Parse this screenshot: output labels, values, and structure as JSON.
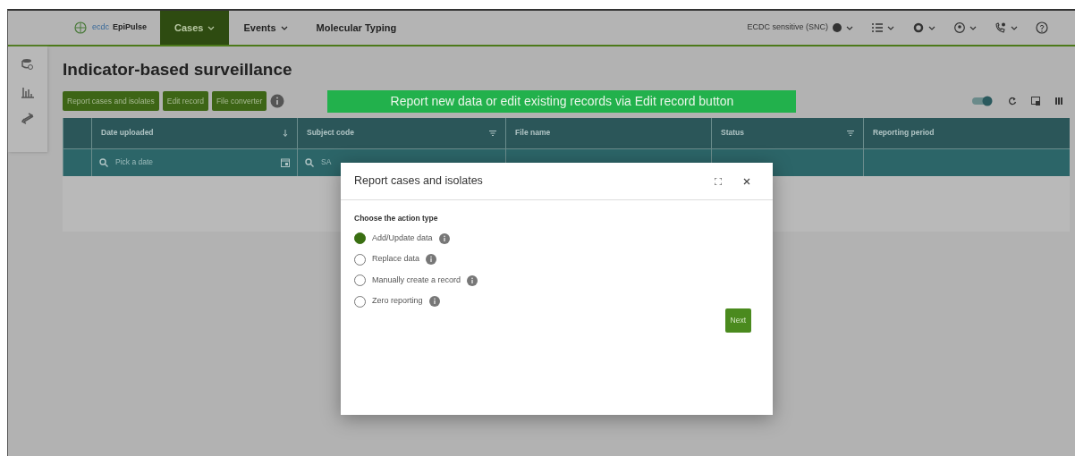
{
  "navbar": {
    "brand": "EpiPulse",
    "logo_text": "ecdc",
    "menus": [
      {
        "label": "Cases",
        "selected": true,
        "dropdown": true
      },
      {
        "label": "Events",
        "selected": false,
        "dropdown": true
      },
      {
        "label": "Molecular Typing",
        "selected": false,
        "dropdown": false
      }
    ],
    "sensitivity": "ECDC sensitive (SNC)"
  },
  "page": {
    "title": "Indicator-based surveillance",
    "actions": [
      "Report cases and isolates",
      "Edit record",
      "File converter"
    ],
    "banner": "Report new data or edit existing records via Edit record button",
    "toggle": {
      "on": true
    }
  },
  "table": {
    "columns": [
      {
        "label": "Date uploaded",
        "kind": "sort"
      },
      {
        "label": "Subject code",
        "kind": "filter"
      },
      {
        "label": "File name",
        "kind": "plain"
      },
      {
        "label": "Status",
        "kind": "filter"
      },
      {
        "label": "Reporting period",
        "kind": "plain"
      }
    ],
    "filters": [
      {
        "placeholder": "Pick a date",
        "kind": "date"
      },
      {
        "placeholder": "SA",
        "kind": "search"
      },
      {
        "kind": "none"
      },
      {
        "kind": "none"
      },
      {
        "kind": "none"
      }
    ]
  },
  "dialog": {
    "title": "Report cases and isolates",
    "prompt": "Choose the action type",
    "options": [
      {
        "label": "Add/Update data",
        "selected": true
      },
      {
        "label": "Replace data",
        "selected": false
      },
      {
        "label": "Manually create a record",
        "selected": false
      },
      {
        "label": "Zero reporting",
        "selected": false
      }
    ],
    "button": "Next"
  }
}
